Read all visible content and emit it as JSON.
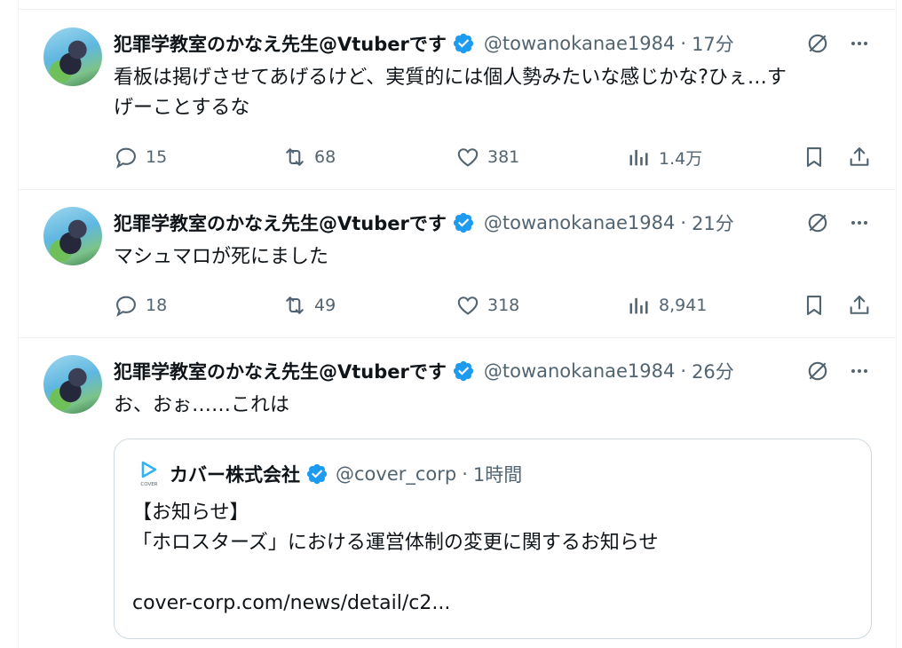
{
  "tweets": [
    {
      "name": "犯罪学教室のかなえ先生@Vtuberです",
      "handle": "@towanokanae1984",
      "time": "17分",
      "text_lines": [
        "看板は掲げさせてあげるけど、実質的には個人勢みたいな感じかな?ひぇ…す",
        "げーことするな"
      ],
      "replies": "15",
      "reposts": "68",
      "likes": "381",
      "views": "1.4万"
    },
    {
      "name": "犯罪学教室のかなえ先生@Vtuberです",
      "handle": "@towanokanae1984",
      "time": "21分",
      "text_lines": [
        "マシュマロが死にました"
      ],
      "replies": "18",
      "reposts": "49",
      "likes": "318",
      "views": "8,941"
    },
    {
      "name": "犯罪学教室のかなえ先生@Vtuberです",
      "handle": "@towanokanae1984",
      "time": "26分",
      "text_lines": [
        "お、おぉ……これは"
      ],
      "quote": {
        "logo_text": "COVER",
        "name": "カバー株式会社",
        "handle": "@cover_corp",
        "time": "1時間",
        "lines": [
          "【お知らせ】",
          "「ホロスターズ」における運営体制の変更に関するお知らせ",
          "",
          "cover-corp.com/news/detail/c2..."
        ]
      }
    }
  ],
  "separator": "·",
  "colors": {
    "verified": "#1d9bf0",
    "secondary": "#536471",
    "border": "#eff3f4",
    "cover_logo": "#2fb4f0"
  },
  "icons": [
    "avatar",
    "verified-badge-icon",
    "grok-icon",
    "more-icon",
    "reply-icon",
    "repost-icon",
    "like-icon",
    "views-icon",
    "bookmark-icon",
    "share-icon",
    "cover-logo"
  ]
}
